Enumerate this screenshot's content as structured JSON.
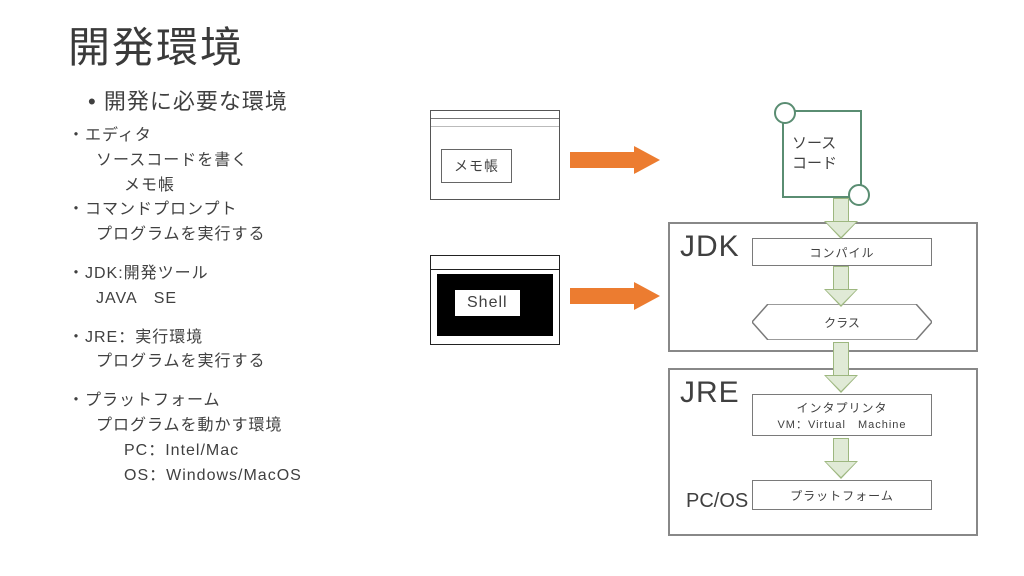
{
  "title": "開発環境",
  "subtitle": "• 開発に必要な環境",
  "bullets": {
    "editor_h": "・エディタ",
    "editor_l1": "ソースコードを書く",
    "editor_l2": "メモ帳",
    "cmd_h": "・コマンドプロンプト",
    "cmd_l1": "プログラムを実行する",
    "jdk_h": "・JDK:開発ツール",
    "jdk_l1": "JAVA　SE",
    "jre_h": "・JRE：実行環境",
    "jre_l1": "プログラムを実行する",
    "pf_h": "・プラットフォーム",
    "pf_l1": "プログラムを動かす環境",
    "pf_l2": "PC：Intel/Mac",
    "pf_l3": "OS：Windows/MacOS"
  },
  "diagram": {
    "notepad_label": "メモ帳",
    "shell_label": "Shell",
    "source_l1": "ソース",
    "source_l2": "コード",
    "jdk_tag": "JDK",
    "jre_tag": "JRE",
    "pcos": "PC/OS",
    "compile": "コンパイル",
    "class": "クラス",
    "interp_l1": "インタプリンタ",
    "interp_l2": "VM：Virtual　Machine",
    "platform": "プラットフォーム"
  }
}
